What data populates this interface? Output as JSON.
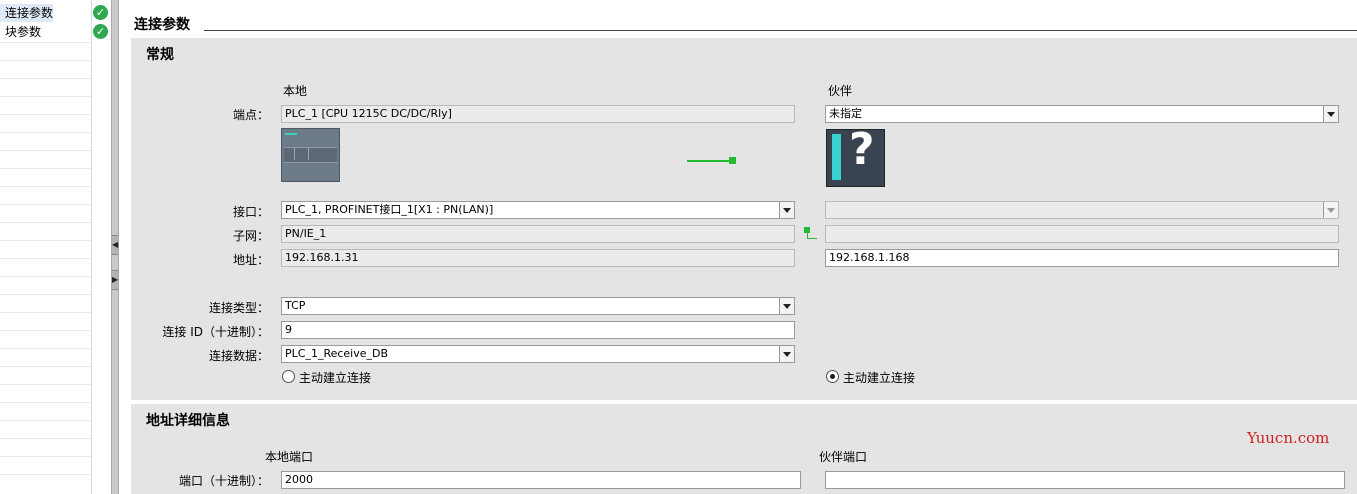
{
  "nav": {
    "items": [
      {
        "label": "连接参数",
        "selected": true,
        "status_icon": "check-circle-icon"
      },
      {
        "label": "块参数",
        "selected": false,
        "status_icon": "check-circle-icon"
      }
    ]
  },
  "section_title": "连接参数",
  "general": {
    "title": "常规",
    "local_header": "本地",
    "partner_header": "伙伴",
    "endpoint_label": "端点：",
    "local_endpoint": "PLC_1 [CPU 1215C DC/DC/Rly]",
    "partner_endpoint": "未指定",
    "interface_label": "接口：",
    "local_interface": "PLC_1, PROFINET接口_1[X1 : PN(LAN)]",
    "partner_interface": "",
    "subnet_label": "子网：",
    "local_subnet": "PN/IE_1",
    "partner_subnet": "",
    "address_label": "地址：",
    "local_address": "192.168.1.31",
    "partner_address": "192.168.1.168",
    "conn_type_label": "连接类型：",
    "conn_type": "TCP",
    "conn_id_label": "连接 ID（十进制）：",
    "conn_id": "9",
    "conn_data_label": "连接数据：",
    "conn_data": "PLC_1_Receive_DB",
    "local_active_label": "主动建立连接",
    "local_active": false,
    "partner_active_label": "主动建立连接",
    "partner_active": true
  },
  "address_details": {
    "title": "地址详细信息",
    "local_port_header": "本地端口",
    "partner_port_header": "伙伴端口",
    "port_label": "端口（十进制）：",
    "local_port": "2000",
    "partner_port": ""
  },
  "watermark": "Yuucn.com",
  "colors": {
    "accent_green": "#22bb33",
    "check_green": "#2fa84f",
    "watermark": "#cc2222"
  }
}
